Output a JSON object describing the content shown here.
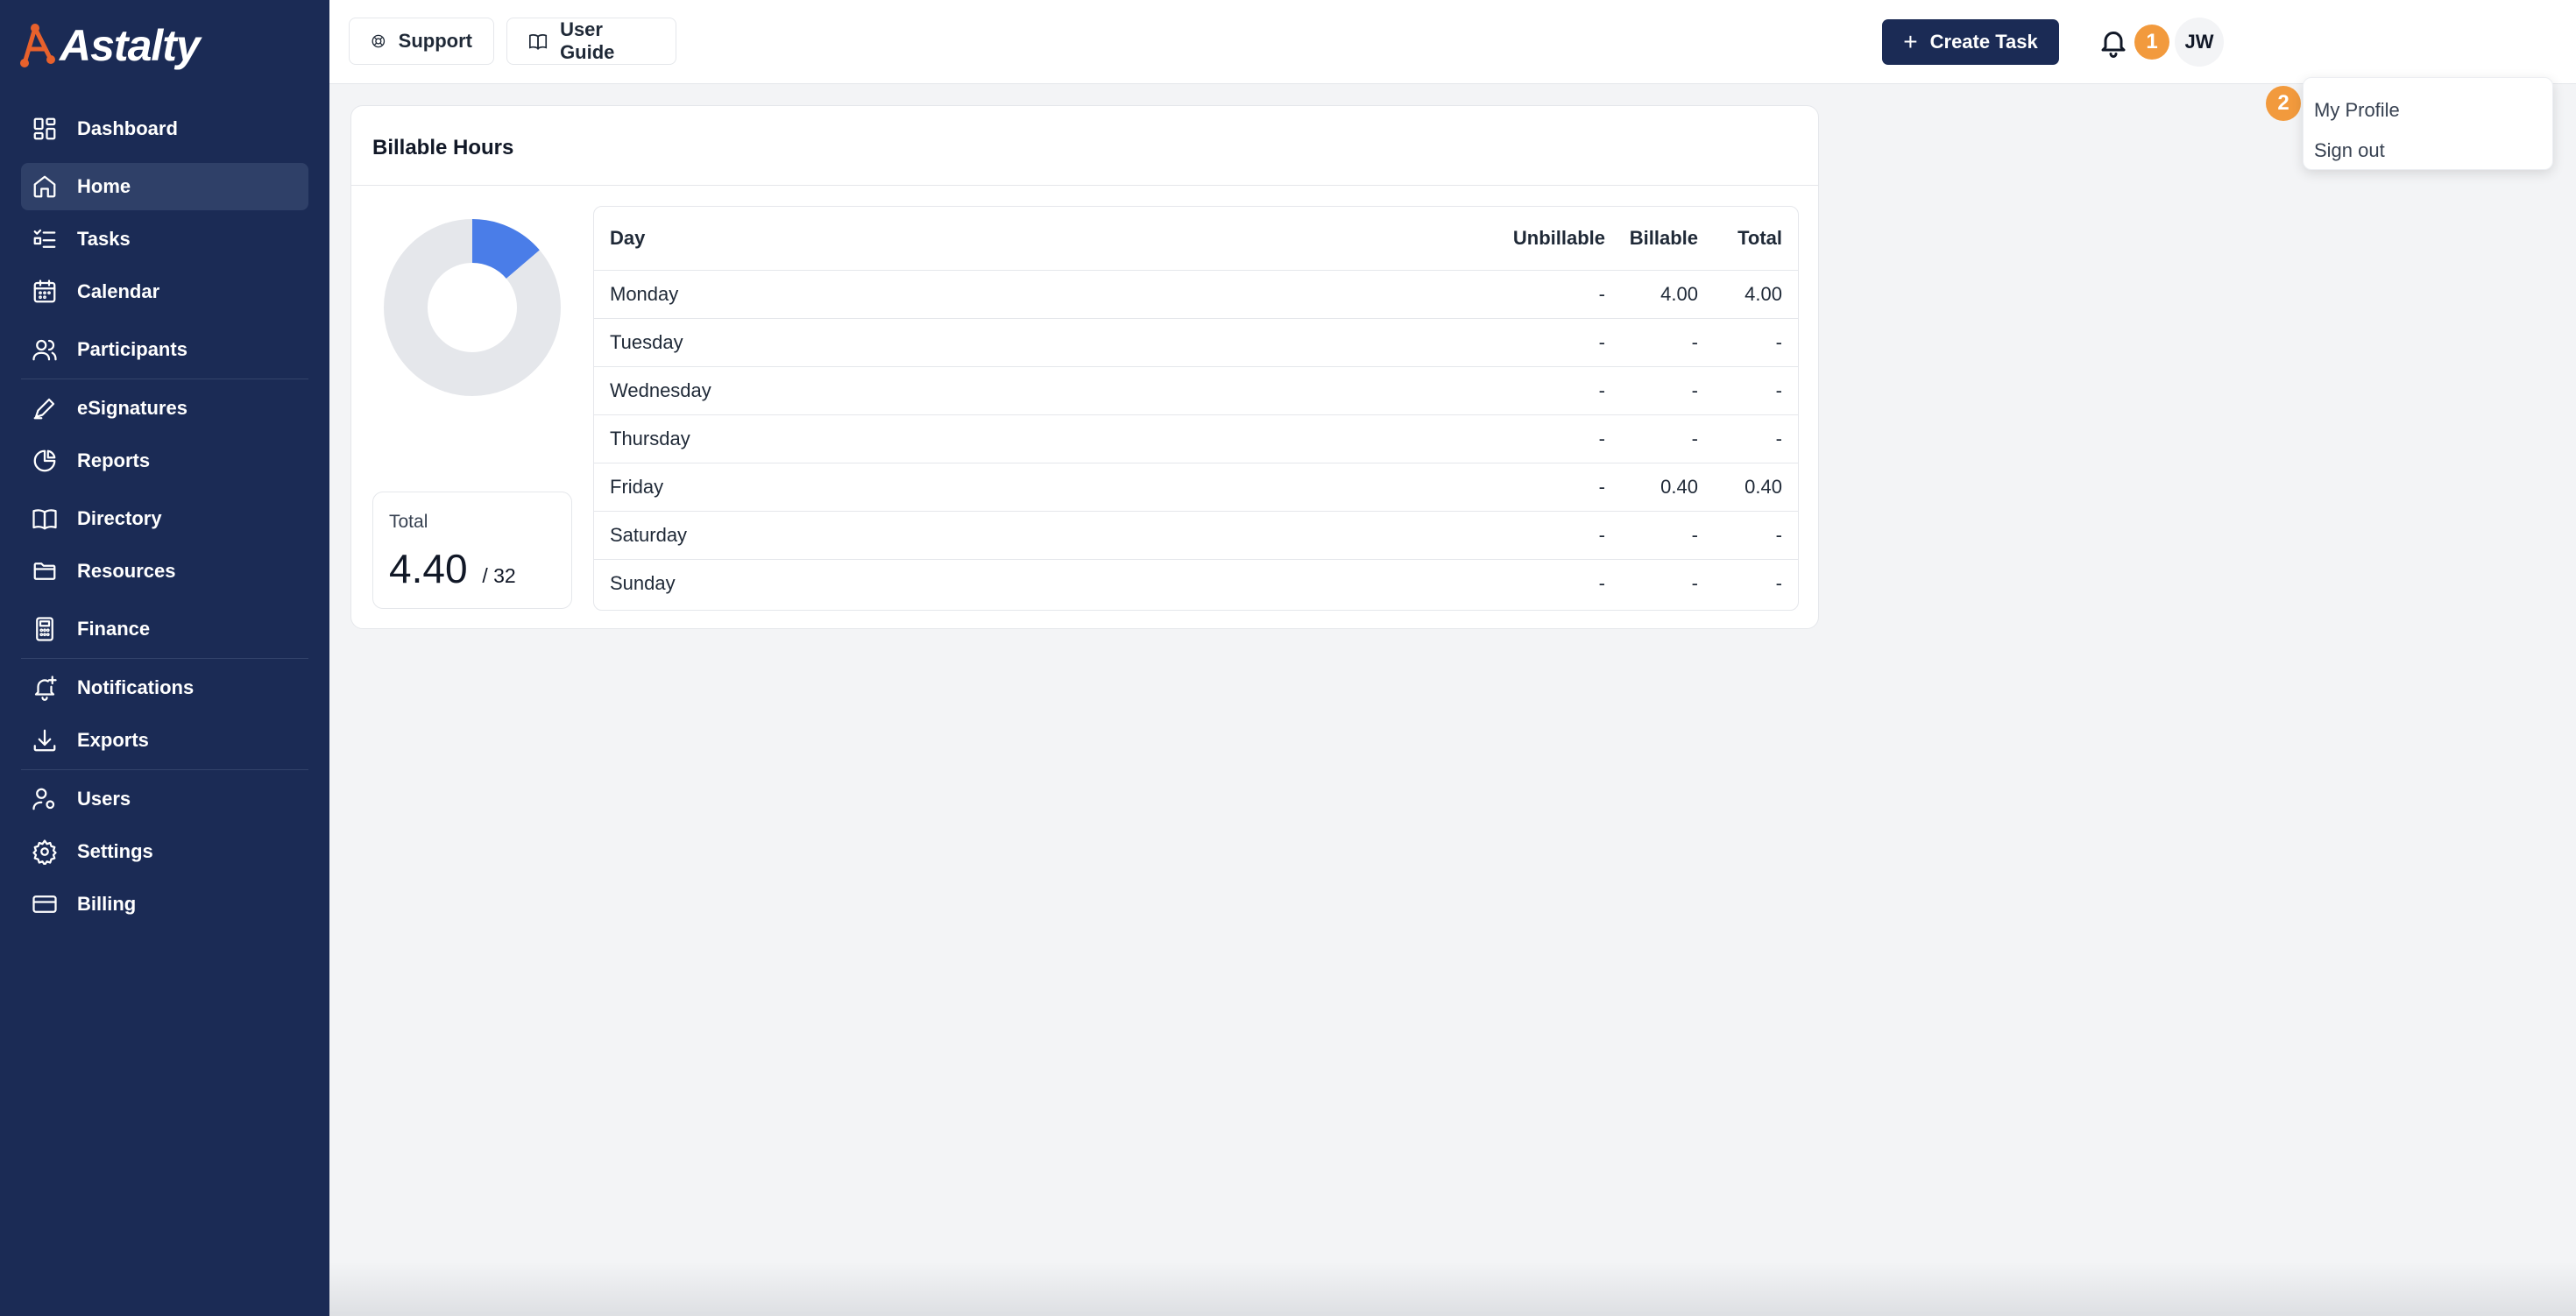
{
  "brand": {
    "name": "Astalty",
    "accent": "#e8612c",
    "sidebar_bg": "#1b2b55"
  },
  "sidebar": {
    "items": [
      {
        "label": "Dashboard",
        "icon": "dashboard-icon"
      },
      {
        "label": "Home",
        "icon": "home-icon",
        "active": true
      },
      {
        "label": "Tasks",
        "icon": "tasks-icon"
      },
      {
        "label": "Calendar",
        "icon": "calendar-icon"
      },
      {
        "label": "Participants",
        "icon": "users-icon"
      },
      {
        "label": "eSignatures",
        "icon": "pen-icon"
      },
      {
        "label": "Reports",
        "icon": "pie-chart-icon"
      },
      {
        "label": "Directory",
        "icon": "book-icon"
      },
      {
        "label": "Resources",
        "icon": "folder-icon"
      },
      {
        "label": "Finance",
        "icon": "calculator-icon"
      },
      {
        "label": "Notifications",
        "icon": "bell-plus-icon"
      },
      {
        "label": "Exports",
        "icon": "download-icon"
      },
      {
        "label": "Users",
        "icon": "user-gear-icon"
      },
      {
        "label": "Settings",
        "icon": "gear-icon"
      },
      {
        "label": "Billing",
        "icon": "credit-card-icon"
      }
    ]
  },
  "topbar": {
    "support_label": "Support",
    "guide_label": "User Guide",
    "create_label": "Create Task",
    "badge_1": "1",
    "avatar_initials": "JW"
  },
  "user_menu": {
    "badge_2": "2",
    "items": [
      "My Profile",
      "Sign out"
    ]
  },
  "billable": {
    "title": "Billable Hours",
    "total_label": "Total",
    "total_value": "4.40",
    "total_of": "/ 32",
    "columns": [
      "Day",
      "Unbillable",
      "Billable",
      "Total"
    ],
    "rows": [
      [
        "Monday",
        "-",
        "4.00",
        "4.00"
      ],
      [
        "Tuesday",
        "-",
        "-",
        "-"
      ],
      [
        "Wednesday",
        "-",
        "-",
        "-"
      ],
      [
        "Thursday",
        "-",
        "-",
        "-"
      ],
      [
        "Friday",
        "-",
        "0.40",
        "0.40"
      ],
      [
        "Saturday",
        "-",
        "-",
        "-"
      ],
      [
        "Sunday",
        "-",
        "-",
        "-"
      ]
    ],
    "donut": {
      "value": 4.4,
      "max": 32,
      "fill_color": "#4a7de8",
      "track_color": "#e5e7eb"
    }
  }
}
